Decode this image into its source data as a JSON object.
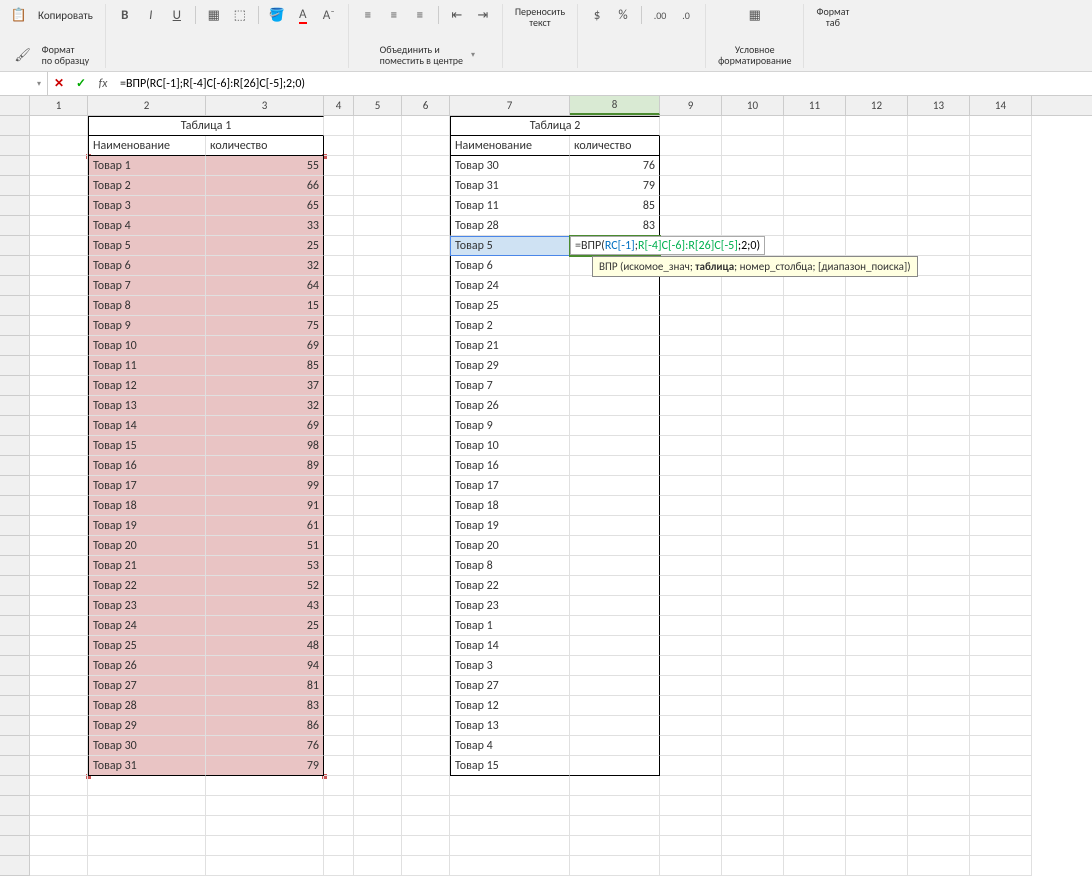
{
  "ribbon": {
    "copy": "Копировать",
    "format_painter": "Формат\nпо образцу",
    "merge_center": "Объединить и\nпоместить в центре",
    "wrap_text": "Переносить\nтекст",
    "conditional_fmt": "Условное\nформатирование",
    "format_tab": "Формат\nтаб"
  },
  "formula_bar": {
    "formula": "=ВПР(RC[-1];R[-4]C[-6]:R[26]C[-5];2;0)"
  },
  "col_headers": [
    "1",
    "2",
    "3",
    "4",
    "5",
    "6",
    "7",
    "8",
    "9",
    "10",
    "11",
    "12",
    "13",
    "14"
  ],
  "table1": {
    "title": "Таблица 1",
    "col1": "Наименование",
    "col2": "количество",
    "rows": [
      {
        "n": "Товар 1",
        "q": 55
      },
      {
        "n": "Товар 2",
        "q": 66
      },
      {
        "n": "Товар 3",
        "q": 65
      },
      {
        "n": "Товар 4",
        "q": 33
      },
      {
        "n": "Товар 5",
        "q": 25
      },
      {
        "n": "Товар 6",
        "q": 32
      },
      {
        "n": "Товар 7",
        "q": 64
      },
      {
        "n": "Товар 8",
        "q": 15
      },
      {
        "n": "Товар 9",
        "q": 75
      },
      {
        "n": "Товар 10",
        "q": 69
      },
      {
        "n": "Товар 11",
        "q": 85
      },
      {
        "n": "Товар 12",
        "q": 37
      },
      {
        "n": "Товар 13",
        "q": 32
      },
      {
        "n": "Товар 14",
        "q": 69
      },
      {
        "n": "Товар 15",
        "q": 98
      },
      {
        "n": "Товар 16",
        "q": 89
      },
      {
        "n": "Товар 17",
        "q": 99
      },
      {
        "n": "Товар 18",
        "q": 91
      },
      {
        "n": "Товар 19",
        "q": 61
      },
      {
        "n": "Товар 20",
        "q": 51
      },
      {
        "n": "Товар 21",
        "q": 53
      },
      {
        "n": "Товар 22",
        "q": 52
      },
      {
        "n": "Товар 23",
        "q": 43
      },
      {
        "n": "Товар 24",
        "q": 25
      },
      {
        "n": "Товар 25",
        "q": 48
      },
      {
        "n": "Товар 26",
        "q": 94
      },
      {
        "n": "Товар 27",
        "q": 81
      },
      {
        "n": "Товар 28",
        "q": 83
      },
      {
        "n": "Товар 29",
        "q": 86
      },
      {
        "n": "Товар 30",
        "q": 76
      },
      {
        "n": "Товар 31",
        "q": 79
      }
    ]
  },
  "table2": {
    "title": "Таблица 2",
    "col1": "Наименование",
    "col2": "количество",
    "rows": [
      {
        "n": "Товар 30",
        "q": "76"
      },
      {
        "n": "Товар 31",
        "q": "79"
      },
      {
        "n": "Товар 11",
        "q": "85"
      },
      {
        "n": "Товар 28",
        "q": "83"
      },
      {
        "n": "Товар 5",
        "q": ""
      },
      {
        "n": "Товар 6",
        "q": ""
      },
      {
        "n": "Товар 24",
        "q": ""
      },
      {
        "n": "Товар 25",
        "q": ""
      },
      {
        "n": "Товар 2",
        "q": ""
      },
      {
        "n": "Товар 21",
        "q": ""
      },
      {
        "n": "Товар 29",
        "q": ""
      },
      {
        "n": "Товар 7",
        "q": ""
      },
      {
        "n": "Товар 26",
        "q": ""
      },
      {
        "n": "Товар 9",
        "q": ""
      },
      {
        "n": "Товар 10",
        "q": ""
      },
      {
        "n": "Товар 16",
        "q": ""
      },
      {
        "n": "Товар 17",
        "q": ""
      },
      {
        "n": "Товар 18",
        "q": ""
      },
      {
        "n": "Товар 19",
        "q": ""
      },
      {
        "n": "Товар 20",
        "q": ""
      },
      {
        "n": "Товар 8",
        "q": ""
      },
      {
        "n": "Товар 22",
        "q": ""
      },
      {
        "n": "Товар 23",
        "q": ""
      },
      {
        "n": "Товар 1",
        "q": ""
      },
      {
        "n": "Товар 14",
        "q": ""
      },
      {
        "n": "Товар 3",
        "q": ""
      },
      {
        "n": "Товар 27",
        "q": ""
      },
      {
        "n": "Товар 12",
        "q": ""
      },
      {
        "n": "Товар 13",
        "q": ""
      },
      {
        "n": "Товар 4",
        "q": ""
      },
      {
        "n": "Товар 15",
        "q": ""
      }
    ]
  },
  "editing": {
    "prefix": "=ВПР(",
    "arg1": " RC[-1] ",
    "sep1": "; ",
    "arg2": "R[-4]C[-6]:R[26]C[-5] ",
    "suffix": ";2;0)"
  },
  "tooltip": {
    "fn": "ВПР",
    "sig": " (искомое_знач; ",
    "bold": "таблица",
    "rest": "; номер_столбца; [диапазон_поиска])"
  }
}
